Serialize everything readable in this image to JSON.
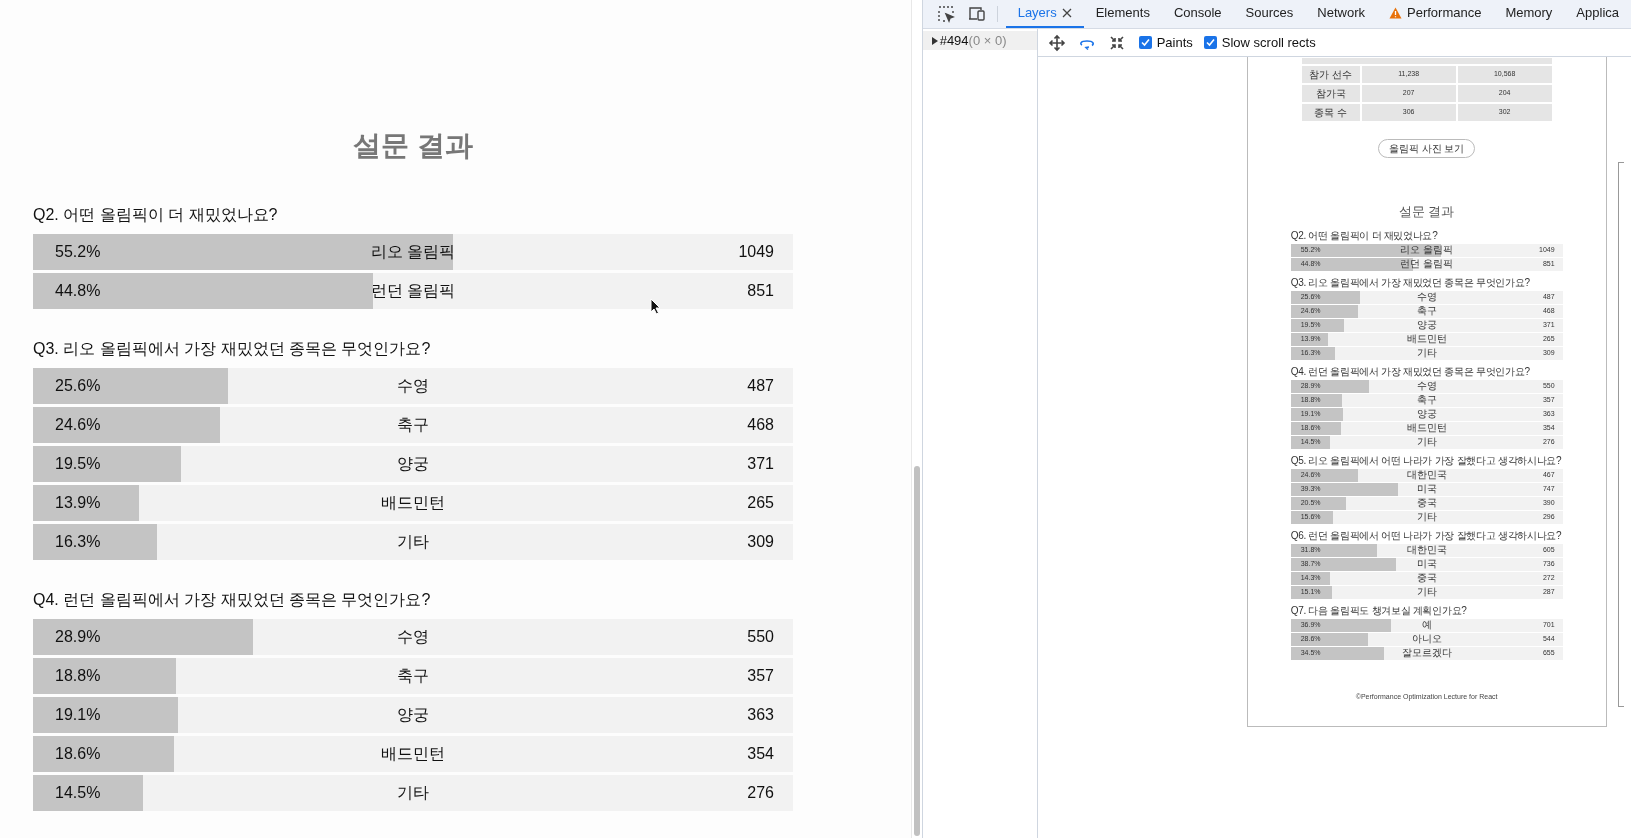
{
  "page": {
    "title": "설문 결과",
    "sections": [
      {
        "question": "Q2. 어떤 올림픽이 더 재밌었나요?",
        "rows": [
          {
            "percent": "55.2%",
            "label": "리오 올림픽",
            "count": "1049",
            "level": 0.552
          },
          {
            "percent": "44.8%",
            "label": "런던 올림픽",
            "count": "851",
            "level": 0.448
          }
        ]
      },
      {
        "question": "Q3. 리오 올림픽에서 가장 재밌었던 종목은 무엇인가요?",
        "rows": [
          {
            "percent": "25.6%",
            "label": "수영",
            "count": "487",
            "level": 0.256
          },
          {
            "percent": "24.6%",
            "label": "축구",
            "count": "468",
            "level": 0.246
          },
          {
            "percent": "19.5%",
            "label": "양궁",
            "count": "371",
            "level": 0.195
          },
          {
            "percent": "13.9%",
            "label": "배드민턴",
            "count": "265",
            "level": 0.139
          },
          {
            "percent": "16.3%",
            "label": "기타",
            "count": "309",
            "level": 0.163
          }
        ]
      },
      {
        "question": "Q4. 런던 올림픽에서 가장 재밌었던 종목은 무엇인가요?",
        "rows": [
          {
            "percent": "28.9%",
            "label": "수영",
            "count": "550",
            "level": 0.289
          },
          {
            "percent": "18.8%",
            "label": "축구",
            "count": "357",
            "level": 0.188
          },
          {
            "percent": "19.1%",
            "label": "양궁",
            "count": "363",
            "level": 0.191
          },
          {
            "percent": "18.6%",
            "label": "배드민턴",
            "count": "354",
            "level": 0.186
          },
          {
            "percent": "14.5%",
            "label": "기타",
            "count": "276",
            "level": 0.145
          }
        ]
      }
    ]
  },
  "devtools": {
    "tabs": [
      {
        "label": "Layers",
        "selected": true,
        "closable": true,
        "warning": false
      },
      {
        "label": "Elements",
        "selected": false,
        "closable": false,
        "warning": false
      },
      {
        "label": "Console",
        "selected": false,
        "closable": false,
        "warning": false
      },
      {
        "label": "Sources",
        "selected": false,
        "closable": false,
        "warning": false
      },
      {
        "label": "Network",
        "selected": false,
        "closable": false,
        "warning": false
      },
      {
        "label": "Performance",
        "selected": false,
        "closable": false,
        "warning": true
      },
      {
        "label": "Memory",
        "selected": false,
        "closable": false,
        "warning": false
      },
      {
        "label": "Applica",
        "selected": false,
        "closable": false,
        "warning": false
      }
    ],
    "layer_tree": [
      {
        "name": "#494",
        "size": "(0 × 0)",
        "expanded": false,
        "selected": true
      }
    ],
    "tools": [
      {
        "kind": "pan",
        "selected": false
      },
      {
        "kind": "rotate",
        "selected": true
      },
      {
        "kind": "reset",
        "selected": false
      }
    ],
    "checkboxes": [
      {
        "label": "Paints",
        "checked": true
      },
      {
        "label": "Slow scroll rects",
        "checked": true
      }
    ],
    "preview": {
      "table_rows": [
        {
          "cells": [
            "참가 선수",
            "11,238",
            "10,568"
          ]
        },
        {
          "cells": [
            "참가국",
            "207",
            "204"
          ]
        },
        {
          "cells": [
            "종목 수",
            "306",
            "302"
          ]
        }
      ],
      "photo_button": "올림픽 사진 보기",
      "title": "설문 결과",
      "sections": [
        {
          "question": "Q2. 어떤 올림픽이 더 재밌었나요?",
          "rows": [
            {
              "percent": "55.2%",
              "label": "리오 올림픽",
              "count": "1049",
              "level": 0.552
            },
            {
              "percent": "44.8%",
              "label": "런던 올림픽",
              "count": "851",
              "level": 0.448
            }
          ]
        },
        {
          "question": "Q3. 리오 올림픽에서 가장 재밌었던 종목은 무엇인가요?",
          "rows": [
            {
              "percent": "25.6%",
              "label": "수영",
              "count": "487",
              "level": 0.256
            },
            {
              "percent": "24.6%",
              "label": "축구",
              "count": "468",
              "level": 0.246
            },
            {
              "percent": "19.5%",
              "label": "양궁",
              "count": "371",
              "level": 0.195
            },
            {
              "percent": "13.9%",
              "label": "배드민턴",
              "count": "265",
              "level": 0.139
            },
            {
              "percent": "16.3%",
              "label": "기타",
              "count": "309",
              "level": 0.163
            }
          ]
        },
        {
          "question": "Q4. 런던 올림픽에서 가장 재밌었던 종목은 무엇인가요?",
          "rows": [
            {
              "percent": "28.9%",
              "label": "수영",
              "count": "550",
              "level": 0.289
            },
            {
              "percent": "18.8%",
              "label": "축구",
              "count": "357",
              "level": 0.188
            },
            {
              "percent": "19.1%",
              "label": "양궁",
              "count": "363",
              "level": 0.191
            },
            {
              "percent": "18.6%",
              "label": "배드민턴",
              "count": "354",
              "level": 0.186
            },
            {
              "percent": "14.5%",
              "label": "기타",
              "count": "276",
              "level": 0.145
            }
          ]
        },
        {
          "question": "Q5. 리오 올림픽에서 어떤 나라가 가장 잘했다고 생각하시나요?",
          "rows": [
            {
              "percent": "24.6%",
              "label": "대한민국",
              "count": "467",
              "level": 0.246
            },
            {
              "percent": "39.3%",
              "label": "미국",
              "count": "747",
              "level": 0.393
            },
            {
              "percent": "20.5%",
              "label": "중국",
              "count": "390",
              "level": 0.205
            },
            {
              "percent": "15.6%",
              "label": "기타",
              "count": "296",
              "level": 0.156
            }
          ]
        },
        {
          "question": "Q6. 런던 올림픽에서 어떤 나라가 가장 잘했다고 생각하시나요?",
          "rows": [
            {
              "percent": "31.8%",
              "label": "대한민국",
              "count": "605",
              "level": 0.318
            },
            {
              "percent": "38.7%",
              "label": "미국",
              "count": "736",
              "level": 0.387
            },
            {
              "percent": "14.3%",
              "label": "중국",
              "count": "272",
              "level": 0.143
            },
            {
              "percent": "15.1%",
              "label": "기타",
              "count": "287",
              "level": 0.151
            }
          ]
        },
        {
          "question": "Q7. 다음 올림픽도 챙겨보실 계획인가요?",
          "rows": [
            {
              "percent": "36.9%",
              "label": "예",
              "count": "701",
              "level": 0.369
            },
            {
              "percent": "28.6%",
              "label": "아니오",
              "count": "544",
              "level": 0.286
            },
            {
              "percent": "34.5%",
              "label": "잘모르겠다",
              "count": "655",
              "level": 0.345
            }
          ]
        }
      ],
      "footer": "©Performance Optimization Lecture for React"
    }
  }
}
